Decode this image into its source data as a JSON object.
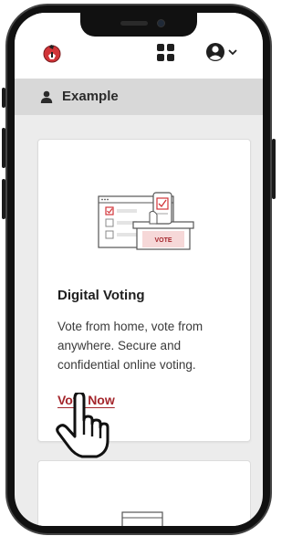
{
  "header": {
    "logo_icon": "app-logo-icon",
    "apps_icon": "apps-grid-icon",
    "account_icon": "account-circle-icon",
    "account_chevron": "chevron-down-icon"
  },
  "subheader": {
    "icon": "person-icon",
    "title": "Example"
  },
  "card": {
    "illustration": "online-voting-illustration",
    "title": "Digital Voting",
    "description": "Vote from home, vote from anywhere. Secure and confidential online voting.",
    "link_label": "Vote Now"
  },
  "cursor": {
    "icon": "hand-pointer-icon"
  },
  "colors": {
    "accent": "#a4262c",
    "subheader_bg": "#d8d8d8",
    "screen_bg": "#ececec"
  }
}
